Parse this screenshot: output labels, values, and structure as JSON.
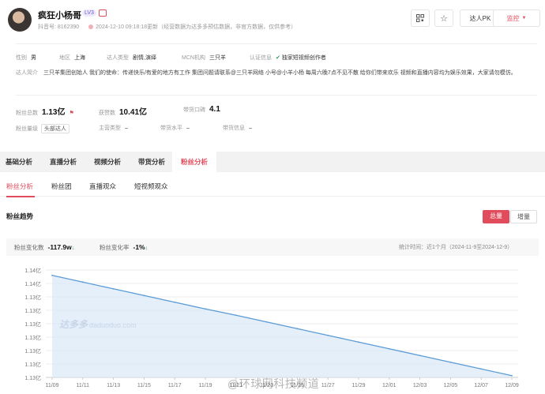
{
  "profile": {
    "name": "疯狂小杨哥",
    "level": "LV3",
    "douyin_id": "抖音号: 8162390",
    "update_note": "2024-12-10 09:18:18更新（经营数据为达多多预估数据，非官方数据，仅供参考）",
    "buttons": {
      "pk": "达人PK",
      "monitor": "监控"
    },
    "gender_label": "性别",
    "gender": "男",
    "region_label": "地区",
    "region": "上海",
    "type_label": "达人类型",
    "type": "剧情,演绎",
    "mcn_label": "MCN机构",
    "mcn": "三只羊",
    "cert_label": "认证信息",
    "cert": "独家短视频创作者",
    "intro_label": "达人简介",
    "intro": "三只羊集团创始人 我们的使命：传递快乐/有爱的地方有工作 集团问题请联系@三只羊网络 小号@小羊小杨 每周六晚7点不见不散 给你们带来欢乐 视频和直播内容均为娱乐效果，大家请勿模仿。",
    "fans_label": "粉丝总数",
    "fans": "1.13亿",
    "likes_label": "获赞数",
    "likes": "10.41亿",
    "rank_label": "带货口碑",
    "rank": "4.1",
    "fans_level_label": "粉丝量级",
    "fans_level": "头部达人",
    "main_type_label": "主营类型",
    "main_type": "–",
    "goods_level_label": "带货水平",
    "goods_level": "–",
    "goods_grade_label": "带货信息",
    "goods_grade": "–"
  },
  "tabs": [
    "基础分析",
    "直播分析",
    "视频分析",
    "带货分析",
    "粉丝分析"
  ],
  "subtabs": [
    "粉丝分析",
    "粉丝团",
    "直播观众",
    "短视频观众"
  ],
  "section": {
    "title": "粉丝趋势",
    "seg_on": "总量",
    "seg_off": "增量",
    "change_label": "粉丝变化数",
    "change_value": "-117.9w",
    "rate_label": "粉丝变化率",
    "rate_value": "-1%",
    "down_arrow": "↓",
    "period": "统计时间：近1个月（2024-11-9至2024-12-9）"
  },
  "watermarks": {
    "logo": "达多多",
    "logo_url": "daduoduo.com",
    "bottom": "@环球网科技频道"
  },
  "chart_data": {
    "type": "area",
    "x_labels": [
      "11/09",
      "11/11",
      "11/13",
      "11/15",
      "11/17",
      "11/19",
      "11/21",
      "11/23",
      "11/25",
      "11/27",
      "11/29",
      "12/01",
      "12/03",
      "12/05",
      "12/07",
      "12/09"
    ],
    "y_tick_labels": [
      "1.14亿",
      "1.14亿",
      "1.13亿",
      "1.13亿",
      "1.13亿",
      "1.13亿",
      "1.13亿",
      "1.13亿",
      "1.13亿"
    ],
    "series": [
      {
        "values": [
          114180000,
          114030000,
          113880000,
          113730000,
          113580000,
          113430000,
          113290000,
          113140000,
          112990000,
          112840000,
          112690000,
          112540000,
          112390000,
          112240000,
          112090000,
          111940000
        ]
      }
    ],
    "ylim": [
      111900000,
      114300000
    ],
    "grid": true,
    "colors": {
      "line": "#5b9bd5",
      "fill": "#dbe9f8",
      "accent": "#e14c5c"
    }
  }
}
